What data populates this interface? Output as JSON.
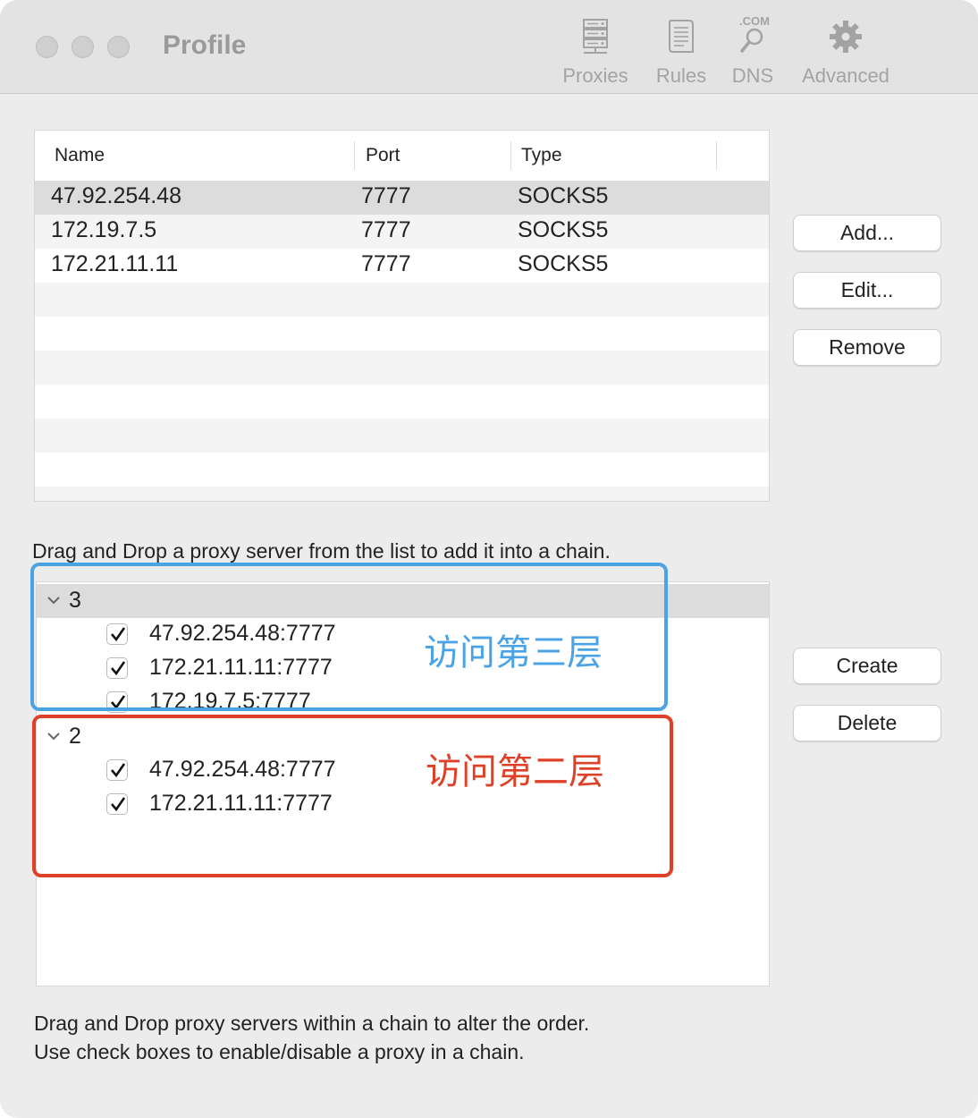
{
  "window": {
    "title": "Profile"
  },
  "toolbar": {
    "items": [
      {
        "label": "Proxies",
        "icon": "server-icon"
      },
      {
        "label": "Rules",
        "icon": "rules-document-icon"
      },
      {
        "label": "DNS",
        "icon": "dns-search-icon",
        "icon_text": ".COM"
      },
      {
        "label": "Advanced",
        "icon": "gear-icon"
      }
    ]
  },
  "proxy_table": {
    "columns": [
      "Name",
      "Port",
      "Type"
    ],
    "rows": [
      {
        "name": "47.92.254.48",
        "port": "7777",
        "type": "SOCKS5",
        "selected": true
      },
      {
        "name": "172.19.7.5",
        "port": "7777",
        "type": "SOCKS5"
      },
      {
        "name": "172.21.11.11",
        "port": "7777",
        "type": "SOCKS5"
      }
    ]
  },
  "proxy_buttons": {
    "add": "Add...",
    "edit": "Edit...",
    "remove": "Remove"
  },
  "hints": {
    "drag_to_chain": "Drag and Drop a proxy server from the list to add it into a chain.",
    "reorder": "Drag and Drop proxy servers within a chain to alter the order.",
    "checkboxes": "Use check boxes to enable/disable a proxy in a chain."
  },
  "chains": [
    {
      "label": "3",
      "expanded": true,
      "items": [
        {
          "address": "47.92.254.48:7777",
          "checked": true
        },
        {
          "address": "172.21.11.11:7777",
          "checked": true
        },
        {
          "address": "172.19.7.5:7777",
          "checked": true
        }
      ]
    },
    {
      "label": "2",
      "expanded": true,
      "items": [
        {
          "address": "47.92.254.48:7777",
          "checked": true
        },
        {
          "address": "172.21.11.11:7777",
          "checked": true
        }
      ]
    }
  ],
  "chain_buttons": {
    "create": "Create",
    "delete": "Delete"
  },
  "annotations": {
    "blue_label": "访问第三层",
    "red_label": "访问第二层",
    "blue_color": "#4ba3e6",
    "red_color": "#df4128"
  }
}
